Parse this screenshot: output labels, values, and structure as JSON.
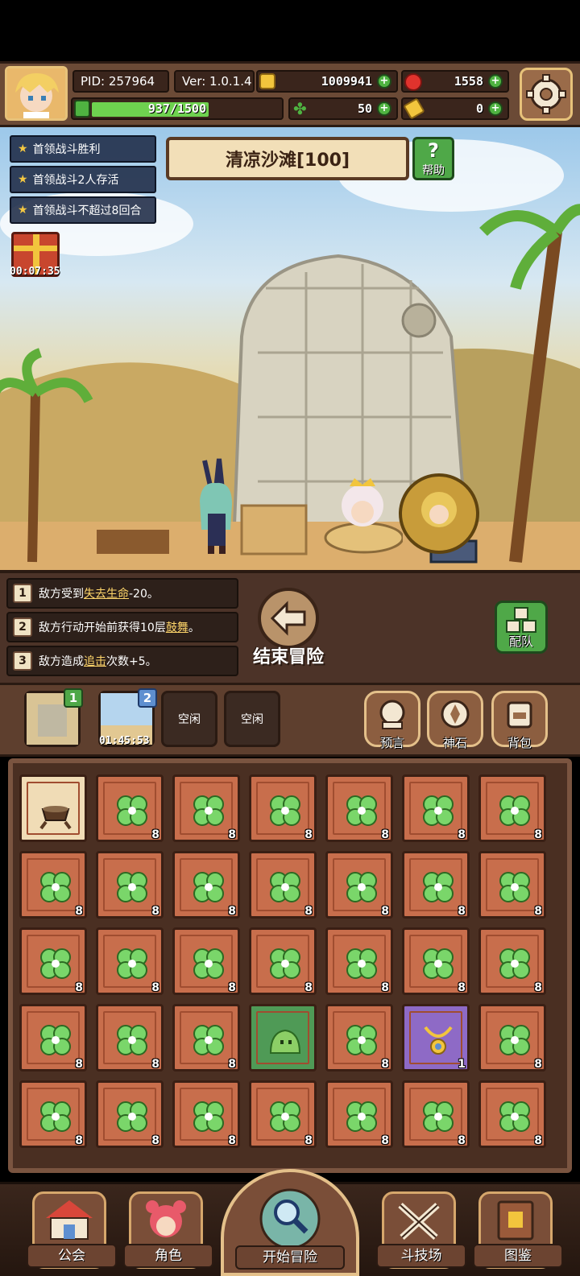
{
  "header": {
    "pid": "PID: 257964",
    "version": "Ver: 1.0.1.4",
    "gold": "1009941",
    "gems": "1558",
    "stamina": "937/1500",
    "stamina_fraction": 0.62,
    "clover_count": "50",
    "ticket_count": "0"
  },
  "goals": [
    "首领战斗胜利",
    "首领战斗2人存活",
    "首领战斗不超过8回合"
  ],
  "gift_timer": "00:07:35",
  "stage_title": "清凉沙滩[100]",
  "help_label": "帮助",
  "buffs": [
    {
      "num": "1",
      "pre": "敌方受到",
      "key": "失去生命",
      "post": "-20。"
    },
    {
      "num": "2",
      "pre": "敌方行动开始前获得10层",
      "key": "鼓舞",
      "post": "。"
    },
    {
      "num": "3",
      "pre": "敌方造成",
      "key": "追击",
      "post": "次数+5。"
    }
  ],
  "end_adventure_label": "结束冒险",
  "team_label": "配队",
  "expeditions": [
    {
      "badge": "1",
      "label": ""
    },
    {
      "badge": "2",
      "label": "01:45:53"
    },
    {
      "badge": "",
      "label": "空闲"
    },
    {
      "badge": "",
      "label": "空闲"
    }
  ],
  "side_buttons": [
    "预言",
    "神石",
    "背包"
  ],
  "inventory_counts": [
    "",
    "8",
    "8",
    "8",
    "8",
    "8",
    "8",
    "8",
    "8",
    "8",
    "8",
    "8",
    "8",
    "8",
    "8",
    "8",
    "8",
    "8",
    "8",
    "8",
    "8",
    "8",
    "8",
    "8",
    "",
    "8",
    "1",
    "8",
    "8",
    "8",
    "8",
    "8",
    "8",
    "8",
    "8"
  ],
  "inventory_types": [
    "pot",
    "clover",
    "clover",
    "clover",
    "clover",
    "clover",
    "clover",
    "clover",
    "clover",
    "clover",
    "clover",
    "clover",
    "clover",
    "clover",
    "clover",
    "clover",
    "clover",
    "clover",
    "clover",
    "clover",
    "clover",
    "clover",
    "clover",
    "clover",
    "slime",
    "clover",
    "amulet",
    "clover",
    "clover",
    "clover",
    "clover",
    "clover",
    "clover",
    "clover",
    "clover"
  ],
  "nav": [
    "公会",
    "角色",
    "开始冒险",
    "斗技场",
    "图鉴"
  ]
}
